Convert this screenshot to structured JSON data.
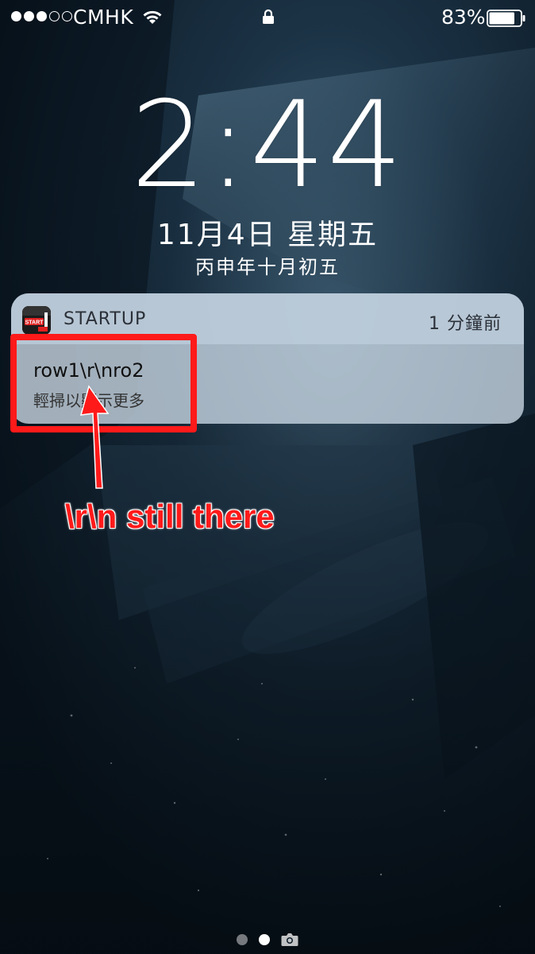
{
  "status_bar": {
    "signal_bars": 5,
    "signal_filled": 3,
    "carrier": "CMHK",
    "wifi_icon": "wifi-icon",
    "lock_icon": "lock-icon",
    "battery_percent": "83%",
    "battery_level": 0.83
  },
  "lock_screen": {
    "time": "2:44",
    "date": "11月4日 星期五",
    "lunar_date": "丙申年十月初五"
  },
  "notification": {
    "app_name": "STARTUP",
    "app_icon": "startup-app-icon",
    "app_icon_text": "START",
    "time": "1 分鐘前",
    "body": "row1\\r\\nro2",
    "hint": "輕掃以顯示更多"
  },
  "annotation": {
    "text": "\\r\\n still there",
    "color": "#ff1a1a"
  },
  "page_indicator": {
    "pages": 2,
    "active": 1,
    "camera_icon": "camera-icon"
  },
  "colors": {
    "highlight": "#ff1a1a",
    "notification_bg": "#c8d6e2"
  }
}
